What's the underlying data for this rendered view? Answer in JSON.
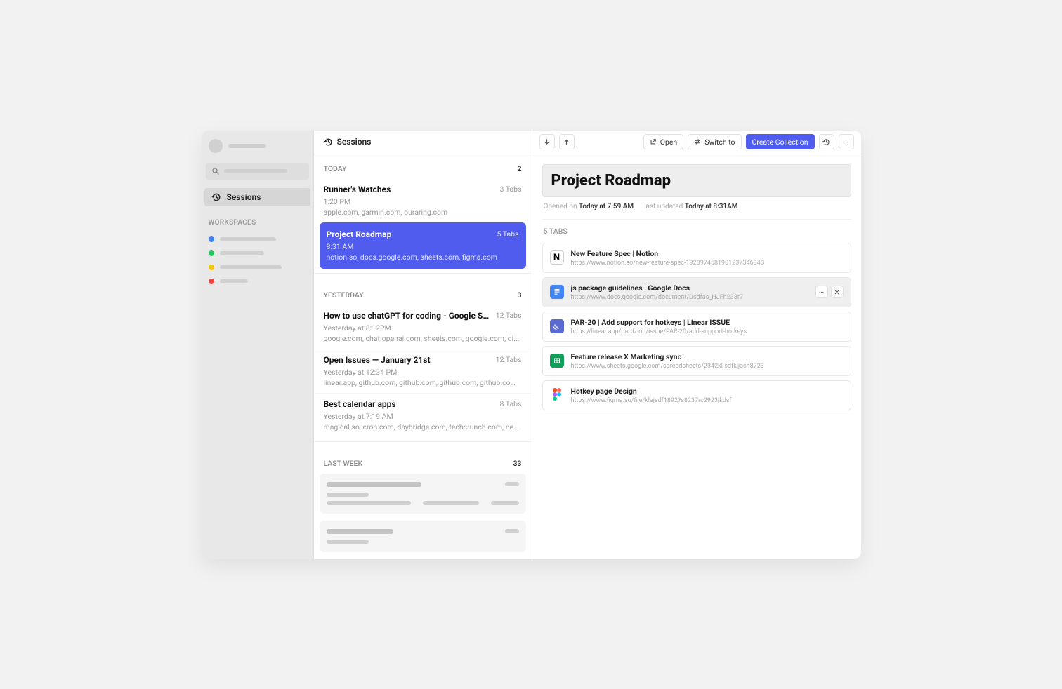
{
  "sidebar": {
    "nav_sessions_label": "Sessions",
    "workspaces_heading": "WORKSPACES",
    "workspace_dots": [
      "#3b82f6",
      "#22c55e",
      "#f59e0b",
      "#ef4444"
    ]
  },
  "mid_header": "Sessions",
  "today": {
    "label": "TODAY",
    "count": "2",
    "items": [
      {
        "title": "Runner's Watches",
        "tabs": "3 Tabs",
        "time": "1:20 PM",
        "hosts": "apple.com, garmin.com, ouraring.com"
      },
      {
        "title": "Project Roadmap",
        "tabs": "5 Tabs",
        "time": "8:31 AM",
        "hosts": "notion.so, docs.google.com, sheets.com, figma.com"
      }
    ]
  },
  "yesterday": {
    "label": "YESTERDAY",
    "count": "3",
    "items": [
      {
        "title": "How to use chatGPT for coding - Google Search",
        "tabs": "12 Tabs",
        "time": "Yesterday at 8:12PM",
        "hosts": "google.com, chat.openai.com, sheets.com, google.com, di..."
      },
      {
        "title": "Open Issues — January 21st",
        "tabs": "12 Tabs",
        "time": "Yesterday at 12:34 PM",
        "hosts": "linear.app, github.com, github.com, github.com, github.com, gith..."
      },
      {
        "title": "Best calendar apps",
        "tabs": "8 Tabs",
        "time": "Yesterday at 7:19 AM",
        "hosts": "magical.so, cron.com, daybridge.com, techcrunch.com, news.yc..."
      }
    ]
  },
  "lastweek": {
    "label": "LAST WEEK",
    "count": "33"
  },
  "toolbar": {
    "open_label": "Open",
    "switch_label": "Switch to",
    "create_label": "Create Collection"
  },
  "detail": {
    "title": "Project Roadmap",
    "opened_label": "Opened on",
    "opened_value": "Today at 7:59 AM",
    "updated_label": "Last updated",
    "updated_value": "Today at 8:31AM",
    "tab_count_label": "5 TABS",
    "tabs": [
      {
        "title": "New Feature Spec | Notion",
        "url": "https://www.notion.so/new-feature-spec-192897458190123734634S"
      },
      {
        "title": "js package guidelines | Google Docs",
        "url": "https://www.docs.google.com/document/Dsdfas_HJFh238r7"
      },
      {
        "title": "PAR-20 | Add support for hotkeys | Linear ISSUE",
        "url": "https://linear.app/partizion/issue/PAR-20/add-support-hotkeys"
      },
      {
        "title": "Feature release X Marketing sync",
        "url": "https://www.sheets.google.com/spreadsheets/2342kl-sdfkljash8723"
      },
      {
        "title": "Hotkey page Design",
        "url": "https://www.figma.so/file/klajsdf1892?s8237rc2923jkdsf"
      }
    ]
  }
}
